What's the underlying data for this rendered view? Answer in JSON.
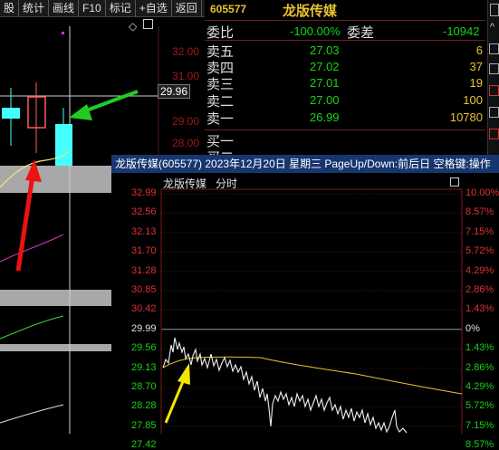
{
  "menubar": [
    "股",
    "统计",
    "画线",
    "F10",
    "标记",
    "+自选",
    "返回"
  ],
  "quote": {
    "code": "605577",
    "name": "龙版传媒",
    "weibi_label": "委比",
    "weibi_value": "-100.00%",
    "weicha_label": "委差",
    "weicha_value": "-10942",
    "asks": [
      {
        "label": "卖五",
        "price": "27.03",
        "vol": "6"
      },
      {
        "label": "卖四",
        "price": "27.02",
        "vol": "37"
      },
      {
        "label": "卖三",
        "price": "27.01",
        "vol": "19"
      },
      {
        "label": "卖二",
        "price": "27.00",
        "vol": "100"
      },
      {
        "label": "卖一",
        "price": "26.99",
        "vol": "10780"
      }
    ],
    "bids": [
      {
        "label": "买一"
      },
      {
        "label": "买二"
      }
    ]
  },
  "kline": {
    "price_ticks": [
      "32.00",
      "31.00",
      "30.00",
      "29.00",
      "28.00"
    ],
    "crosshair_price": "29.96",
    "diamond_icon": "diamond-icon",
    "arrows": {
      "green": "#22cc22",
      "red": "#ee1111"
    }
  },
  "intraday": {
    "title": "龙版传媒(605577) 2023年12月20日 星期三 PageUp/Down:前后日 空格键:操作",
    "name": "龙版传媒",
    "mode": "分时",
    "left_ticks": [
      "32.99",
      "32.56",
      "32.13",
      "31.70",
      "31.28",
      "30.85",
      "30.42",
      "29.99",
      "29.56",
      "29.13",
      "28.70",
      "28.28",
      "27.85",
      "27.42"
    ],
    "right_ticks": [
      "10.00%",
      "8.57%",
      "7.15%",
      "5.72%",
      "4.29%",
      "2.86%",
      "1.43%",
      "0%",
      "1.43%",
      "2.86%",
      "4.29%",
      "5.72%",
      "7.15%",
      "8.57%"
    ],
    "colors": {
      "up": "#e03030",
      "flat": "#e0e0e0",
      "down": "#19d219",
      "avg": "#e7c22f",
      "arrow": "#f2e600"
    }
  }
}
